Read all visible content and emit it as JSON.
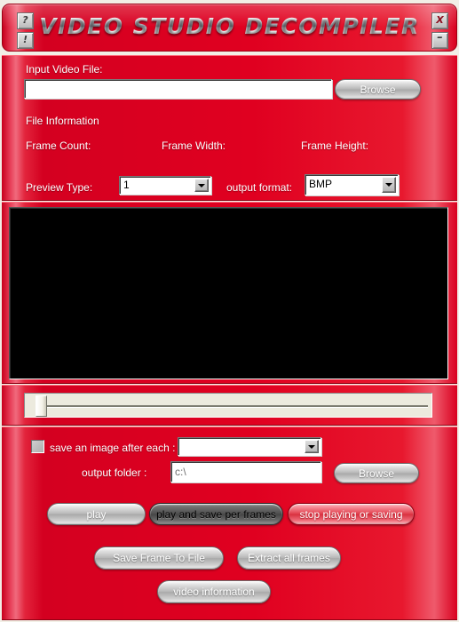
{
  "window": {
    "title": "VIDEO STUDIO DECOMPILER",
    "help_button": "?",
    "about_button": "!",
    "close_button": "X",
    "minimize_button": "–"
  },
  "colors": {
    "panel_red": "#e00020",
    "panel_red_light": "#f06a7d",
    "panel_red_dark": "#8e0012",
    "screen_black": "#000000",
    "button_silver": "#b9b9b9",
    "button_dark": "#4f4f4f",
    "button_red": "#e2414f"
  },
  "settings": {
    "input_label": "Input Video File:",
    "input_value": "",
    "input_placeholder": "",
    "browse_label": "Browse",
    "file_info_label": "File Information",
    "frame_count_label": "Frame Count:",
    "frame_count_value": "",
    "frame_width_label": "Frame Width:",
    "frame_width_value": "",
    "frame_height_label": "Frame Height:",
    "frame_height_value": "",
    "preview_type_label": "Preview Type:",
    "preview_type_value": "1",
    "preview_type_options": [
      "1"
    ],
    "output_format_label": "output format:",
    "output_format_value": "BMP",
    "output_format_options": [
      "BMP"
    ]
  },
  "slider": {
    "position": 0,
    "min": 0,
    "max": 100
  },
  "actions": {
    "save_each_label": "save an image after each :",
    "save_each_checked": false,
    "interval_value": "",
    "interval_options": [],
    "output_folder_label": "output folder :",
    "output_folder_value": "c:\\",
    "output_folder_browse": "Browse",
    "play_label": "play",
    "play_save_label": "play and save per frames",
    "stop_label": "stop playing or saving",
    "save_frame_label": "Save Frame To File",
    "extract_all_label": "Extract all frames",
    "video_info_label": "video information"
  }
}
